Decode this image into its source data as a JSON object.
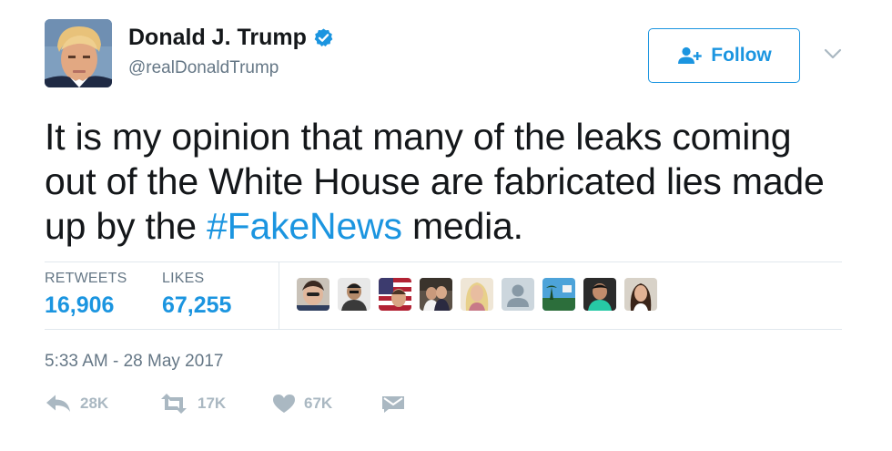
{
  "user": {
    "display_name": "Donald J. Trump",
    "handle": "@realDonaldTrump",
    "verified": true,
    "avatar_icon": "profile-photo"
  },
  "follow_button": {
    "label": "Follow",
    "icon": "add-user-icon"
  },
  "menu_caret_icon": "chevron-down-icon",
  "tweet": {
    "text_before": "It is my opinion that many of the leaks coming out of the White House are fabricated lies made up by the ",
    "hashtag": "#FakeNews",
    "text_after": " media."
  },
  "stats": {
    "retweets_label": "RETWEETS",
    "retweets_value": "16,906",
    "likes_label": "LIKES",
    "likes_value": "67,255"
  },
  "likers_count_shown": 9,
  "timestamp": "5:33 AM - 28 May 2017",
  "actions": {
    "reply_count": "28K",
    "retweet_count": "17K",
    "like_count": "67K"
  },
  "colors": {
    "accent": "#1b95e0",
    "muted": "#657786",
    "icon_muted": "#aab8c2",
    "text": "#14171a",
    "divider": "#e1e8ed"
  }
}
